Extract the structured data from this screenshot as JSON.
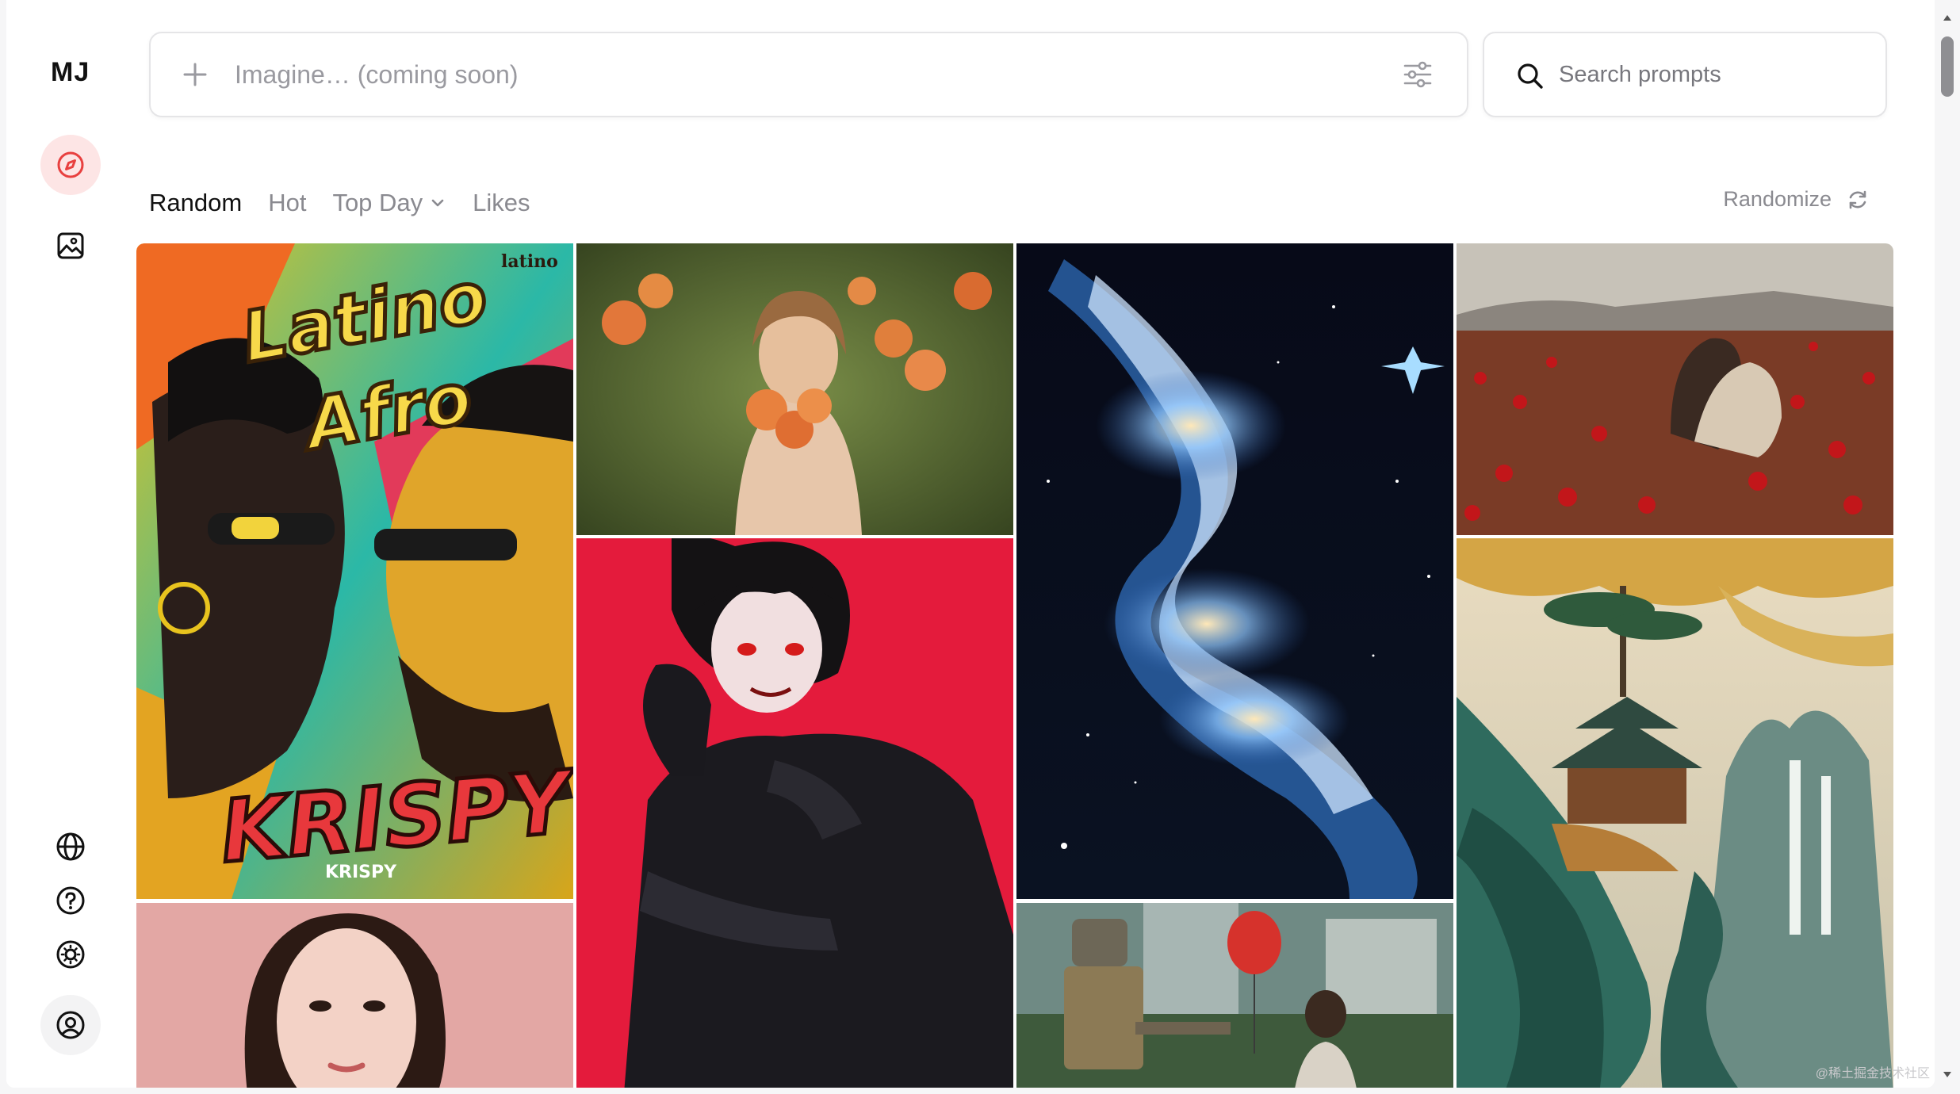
{
  "app": {
    "logo": "MJ"
  },
  "sidebar": {
    "top_items": [
      {
        "name": "explore",
        "icon": "compass-icon",
        "active": true
      },
      {
        "name": "create",
        "icon": "image-icon",
        "active": false
      }
    ],
    "bottom_items": [
      {
        "name": "language",
        "icon": "globe-icon"
      },
      {
        "name": "help",
        "icon": "help-icon"
      },
      {
        "name": "theme",
        "icon": "sun-icon"
      },
      {
        "name": "account",
        "icon": "user-circle-icon"
      }
    ]
  },
  "imagine_bar": {
    "placeholder": "Imagine… (coming soon)"
  },
  "search": {
    "placeholder": "Search prompts"
  },
  "tabs": [
    {
      "label": "Random",
      "active": true
    },
    {
      "label": "Hot",
      "active": false
    },
    {
      "label": "Top Day",
      "active": false,
      "dropdown": true
    },
    {
      "label": "Likes",
      "active": false
    }
  ],
  "randomize": {
    "label": "Randomize"
  },
  "gallery": {
    "items": [
      {
        "subject": "latino-afro-poster",
        "texts": [
          "Latino",
          "Afro",
          "KRISPY",
          "KRISPY",
          "latino"
        ]
      },
      {
        "subject": "girl-with-peaches"
      },
      {
        "subject": "nebula-space"
      },
      {
        "subject": "poppy-field-hug"
      },
      {
        "subject": "anime-boy-red"
      },
      {
        "subject": "chinese-landscape-pagoda"
      },
      {
        "subject": "woman-portrait-pink"
      },
      {
        "subject": "robot-with-balloon"
      }
    ]
  },
  "watermark": "@稀土掘金技术社区",
  "colors": {
    "accent": "#e8403f",
    "active_bg": "#fde5e5",
    "muted_text": "#8a8a90"
  }
}
